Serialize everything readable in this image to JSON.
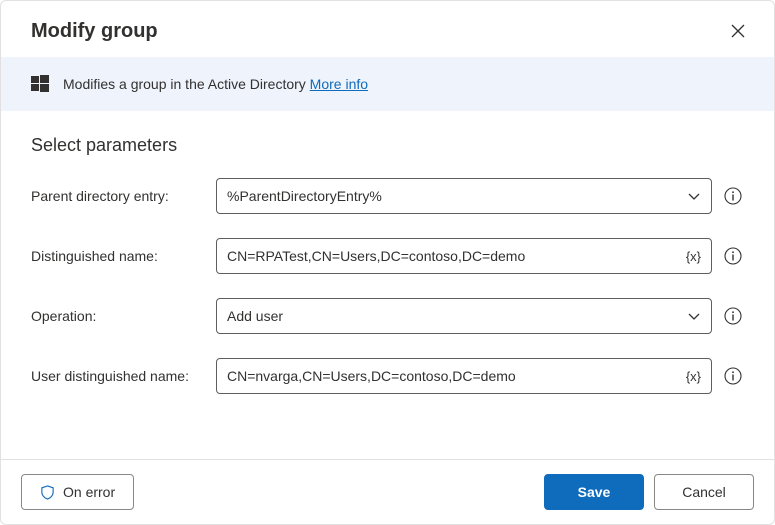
{
  "dialog": {
    "title": "Modify group",
    "banner_text": "Modifies a group in the Active Directory ",
    "more_info": "More info"
  },
  "section": {
    "title": "Select parameters"
  },
  "fields": {
    "parent_label": "Parent directory entry:",
    "parent_value": "%ParentDirectoryEntry%",
    "dn_label": "Distinguished name:",
    "dn_value": "CN=RPATest,CN=Users,DC=contoso,DC=demo",
    "operation_label": "Operation:",
    "operation_value": "Add user",
    "user_dn_label": "User distinguished name:",
    "user_dn_value": "CN=nvarga,CN=Users,DC=contoso,DC=demo",
    "var_token": "{x}"
  },
  "footer": {
    "on_error": "On error",
    "save": "Save",
    "cancel": "Cancel"
  }
}
